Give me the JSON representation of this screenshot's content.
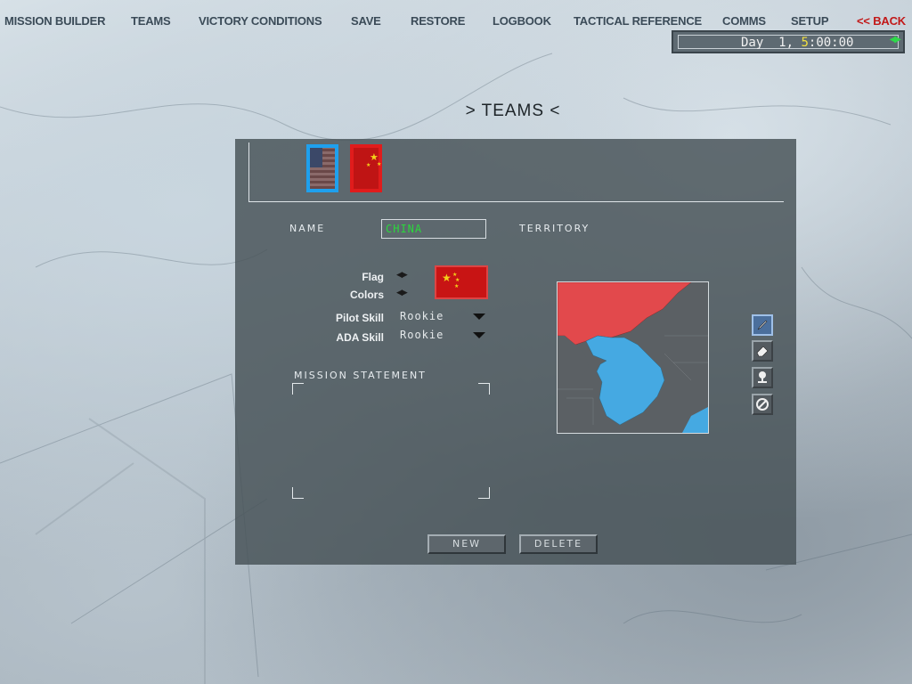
{
  "menu": {
    "items": [
      {
        "label": "MISSION BUILDER"
      },
      {
        "label": "TEAMS"
      },
      {
        "label": "VICTORY CONDITIONS"
      },
      {
        "label": "SAVE"
      },
      {
        "label": "RESTORE"
      },
      {
        "label": "LOGBOOK"
      },
      {
        "label": "TACTICAL REFERENCE"
      },
      {
        "label": "COMMS"
      },
      {
        "label": "SETUP"
      }
    ],
    "back_label": "<< BACK"
  },
  "clock": {
    "day_label": "Day",
    "day": "1,",
    "hour": "5",
    "rest": ":00:00",
    "icon": "play-arrows-icon"
  },
  "screen_title": ">  TEAMS  <",
  "teams": [
    {
      "flag": "usa",
      "selected": false
    },
    {
      "flag": "china",
      "selected": true
    }
  ],
  "form": {
    "name_label": "Name",
    "name_value": "CHINA",
    "territory_label": "Territory",
    "flag_label": "Flag",
    "colors_label": "Colors",
    "pilot_skill_label": "Pilot Skill",
    "pilot_skill_value": "Rookie",
    "ada_skill_label": "ADA Skill",
    "ada_skill_value": "Rookie",
    "mission_statement_label": "Mission Statement",
    "mission_statement_value": ""
  },
  "colors": {
    "team_red": "#c81414",
    "team_blue": "#1ea0ee",
    "name_text": "#2bd83c",
    "back": "#c21818",
    "clock_hour": "#f2e040"
  },
  "tools": [
    "pencil-icon",
    "eraser-icon",
    "stamp-icon",
    "no-entry-icon"
  ],
  "buttons": {
    "new_label": "New",
    "delete_label": "Delete"
  }
}
